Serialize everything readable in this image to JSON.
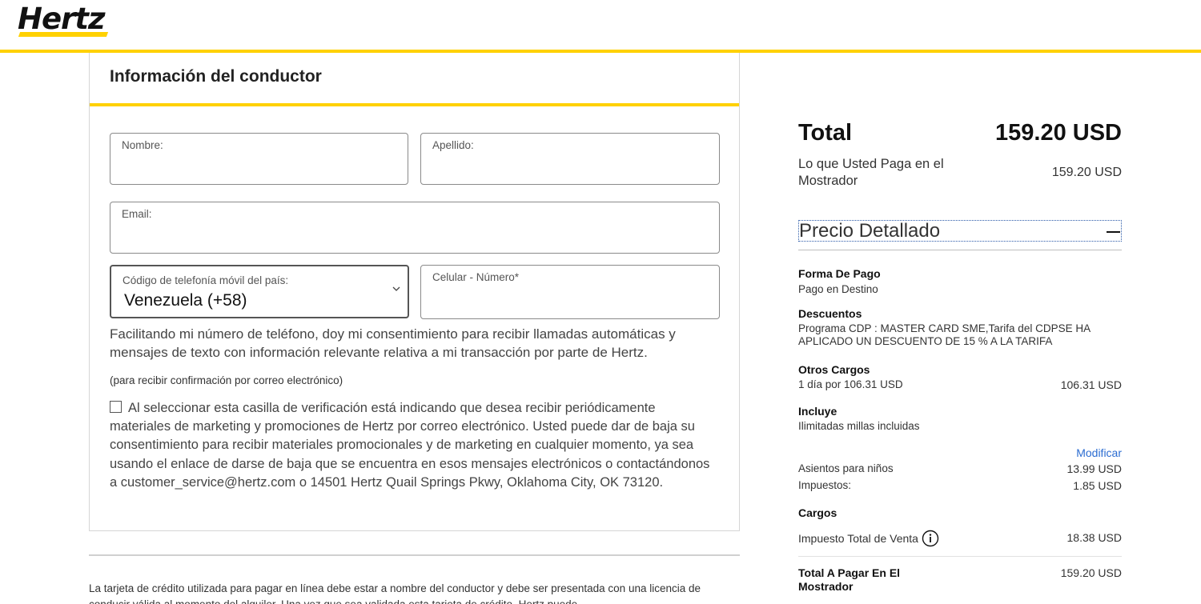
{
  "header": {
    "logo_text": "Hertz",
    "accent_color": "#ffd100"
  },
  "driver_form": {
    "title": "Información del conductor",
    "first_name": {
      "label": "Nombre:",
      "value": ""
    },
    "last_name": {
      "label": "Apellido:",
      "value": ""
    },
    "email": {
      "label": "Email:",
      "value": ""
    },
    "country_code": {
      "label": "Código de telefonía móvil del país:",
      "selected": "Venezuela (+58)"
    },
    "mobile": {
      "label": "Celular - Número*",
      "value": ""
    },
    "phone_consent": "Facilitando mi número de teléfono, doy mi consentimiento para recibir llamadas automáticas y mensajes de texto con información relevante relativa a mi transacción por parte de Hertz.",
    "email_note": "(para recibir confirmación por correo electrónico)",
    "marketing_consent": "Al seleccionar esta casilla de verificación está indicando que desea recibir periódicamente materiales de marketing y promociones de Hertz por correo electrónico. Usted puede dar de baja su consentimiento para recibir materiales promocionales y de marketing en cualquier momento, ya sea usando el enlace de darse de baja que se encuentra en esos mensajes electrónicos o contactándonos a customer_service@hertz.com o 14501 Hertz Quail Springs Pkwy, Oklahoma City, OK 73120.",
    "marketing_checked": false
  },
  "footer_text": "La tarjeta de crédito utilizada para pagar en línea debe estar a nombre del conductor y debe ser presentada con una licencia de conducir válida al momento del alquiler. Una vez que sea validada esta tarjeta de crédito, Hertz puede",
  "summary": {
    "total_label": "Total",
    "total_value": "159.20 USD",
    "counter_label": "Lo que Usted Paga en el Mostrador",
    "counter_value": "159.20 USD",
    "detail_title": "Precio Detallado",
    "payment": {
      "title": "Forma De Pago",
      "text": "Pago en Destino"
    },
    "discounts": {
      "title": "Descuentos",
      "text": "Programa CDP : MASTER CARD SME,Tarifa del CDPSE HA APLICADO UN DESCUENTO DE 15 % A LA TARIFA"
    },
    "other_charges": {
      "title": "Otros Cargos",
      "text": "1 día por 106.31 USD",
      "amount": "106.31 USD"
    },
    "includes": {
      "title": "Incluye",
      "text": "Ilimitadas millas incluidas"
    },
    "modify_link": "Modificar",
    "child_seats": {
      "label": "Asientos para niños",
      "amount": "13.99 USD"
    },
    "taxes": {
      "label": "Impuestos:",
      "amount": "1.85 USD"
    },
    "charges_title": "Cargos",
    "sales_tax": {
      "label": "Impuesto Total de Venta",
      "amount": "18.38 USD"
    },
    "counter_total": {
      "label": "Total A Pagar En El Mostrador",
      "amount": "159.20 USD"
    }
  }
}
